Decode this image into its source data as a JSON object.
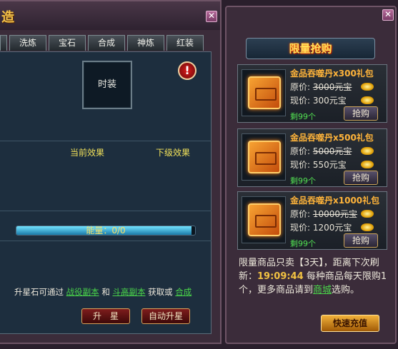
{
  "left": {
    "title": "造",
    "close": "✕",
    "tabs": [
      "",
      "洗炼",
      "宝石",
      "合成",
      "神炼",
      "红装"
    ],
    "slot_label": "时装",
    "warning": "!",
    "current_effect": "当前效果",
    "next_effect": "下级效果",
    "energy_label": "能量：0/0",
    "energy_fraction": 0.98,
    "info_prefix": "升星石可通过",
    "info_link1": "战役副本",
    "info_and": "和",
    "info_link2": "斗高副本",
    "info_mid": "获取或",
    "info_link3": "合成",
    "btn_upgrade": "升　星",
    "btn_auto": "自动升星"
  },
  "right": {
    "close": "✕",
    "header": "限量抢购",
    "items": [
      {
        "name": "金品吞噬丹x300礼包",
        "orig_label": "原价:",
        "orig_price": "3000元宝",
        "now_label": "现价:",
        "now_price": "300元宝",
        "remain": "剩99个",
        "buy": "抢购"
      },
      {
        "name": "金品吞噬丹x500礼包",
        "orig_label": "原价:",
        "orig_price": "5000元宝",
        "now_label": "现价:",
        "now_price": "550元宝",
        "remain": "剩99个",
        "buy": "抢购"
      },
      {
        "name": "金品吞噬丹x1000礼包",
        "orig_label": "原价:",
        "orig_price": "10000元宝",
        "now_label": "现价:",
        "now_price": "1200元宝",
        "remain": "剩99个",
        "buy": "抢购"
      }
    ],
    "note_a": "限量商品只卖【3天】，距离下次刷新：",
    "note_time": "19:09:44",
    "note_b": " 每种商品每天限购1个，更多商品请到",
    "note_link": "商城",
    "note_c": "选购。",
    "recharge": "快速充值"
  },
  "colors": {
    "panel_bg": "#3b2c3a",
    "content_bg": "#1d2e3e",
    "gold_text": "#f3c24a",
    "green": "#4ad64a",
    "orange_name": "#ffb43a"
  }
}
